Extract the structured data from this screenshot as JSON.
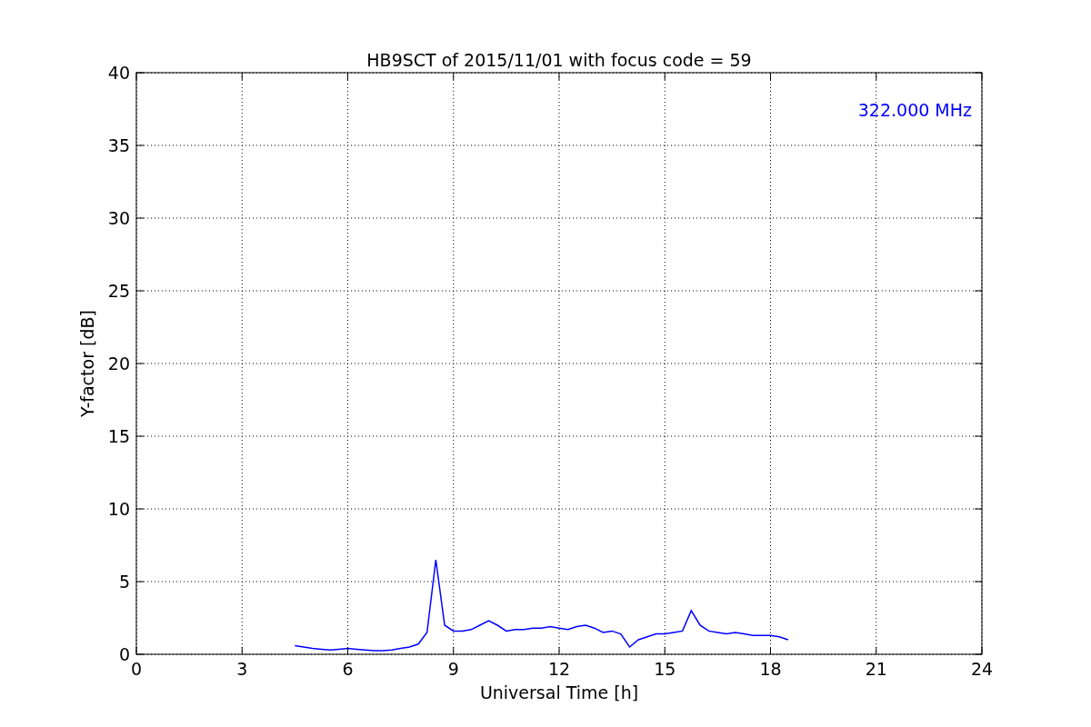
{
  "chart": {
    "chart_data": {
      "type": "line",
      "title": "HB9SCT of 2015/11/01 with focus code = 59",
      "xlabel": "Universal Time [h]",
      "ylabel": "Y-factor [dB]",
      "x": [
        4.5,
        4.75,
        5,
        5.25,
        5.5,
        5.75,
        6,
        6.25,
        6.5,
        6.75,
        7,
        7.25,
        7.5,
        7.75,
        8,
        8.25,
        8.5,
        8.75,
        9,
        9.25,
        9.5,
        9.75,
        10,
        10.25,
        10.5,
        10.75,
        11,
        11.25,
        11.5,
        11.75,
        12,
        12.25,
        12.5,
        12.75,
        13,
        13.25,
        13.5,
        13.75,
        14,
        14.25,
        14.5,
        14.75,
        15,
        15.25,
        15.5,
        15.75,
        16,
        16.25,
        16.5,
        16.75,
        17,
        17.25,
        17.5,
        17.75,
        18,
        18.25,
        18.5
      ],
      "series": [
        {
          "name": "322.000 MHz",
          "color": "#0000ff",
          "values": [
            0.6,
            0.5,
            0.4,
            0.35,
            0.3,
            0.35,
            0.4,
            0.35,
            0.3,
            0.25,
            0.25,
            0.3,
            0.4,
            0.5,
            0.7,
            1.5,
            6.5,
            2.0,
            1.6,
            1.6,
            1.7,
            2.0,
            2.3,
            2.0,
            1.6,
            1.7,
            1.7,
            1.8,
            1.8,
            1.9,
            1.8,
            1.7,
            1.9,
            2.0,
            1.8,
            1.5,
            1.6,
            1.4,
            0.5,
            1.0,
            1.2,
            1.4,
            1.4,
            1.5,
            1.6,
            3.0,
            2.0,
            1.6,
            1.5,
            1.4,
            1.5,
            1.4,
            1.3,
            1.3,
            1.3,
            1.2,
            1.0
          ]
        }
      ],
      "xlim": [
        0,
        24
      ],
      "ylim": [
        0,
        40
      ],
      "xticks": [
        0,
        3,
        6,
        9,
        12,
        15,
        18,
        21,
        24
      ],
      "yticks": [
        0,
        5,
        10,
        15,
        20,
        25,
        30,
        35,
        40
      ],
      "grid": true
    }
  }
}
